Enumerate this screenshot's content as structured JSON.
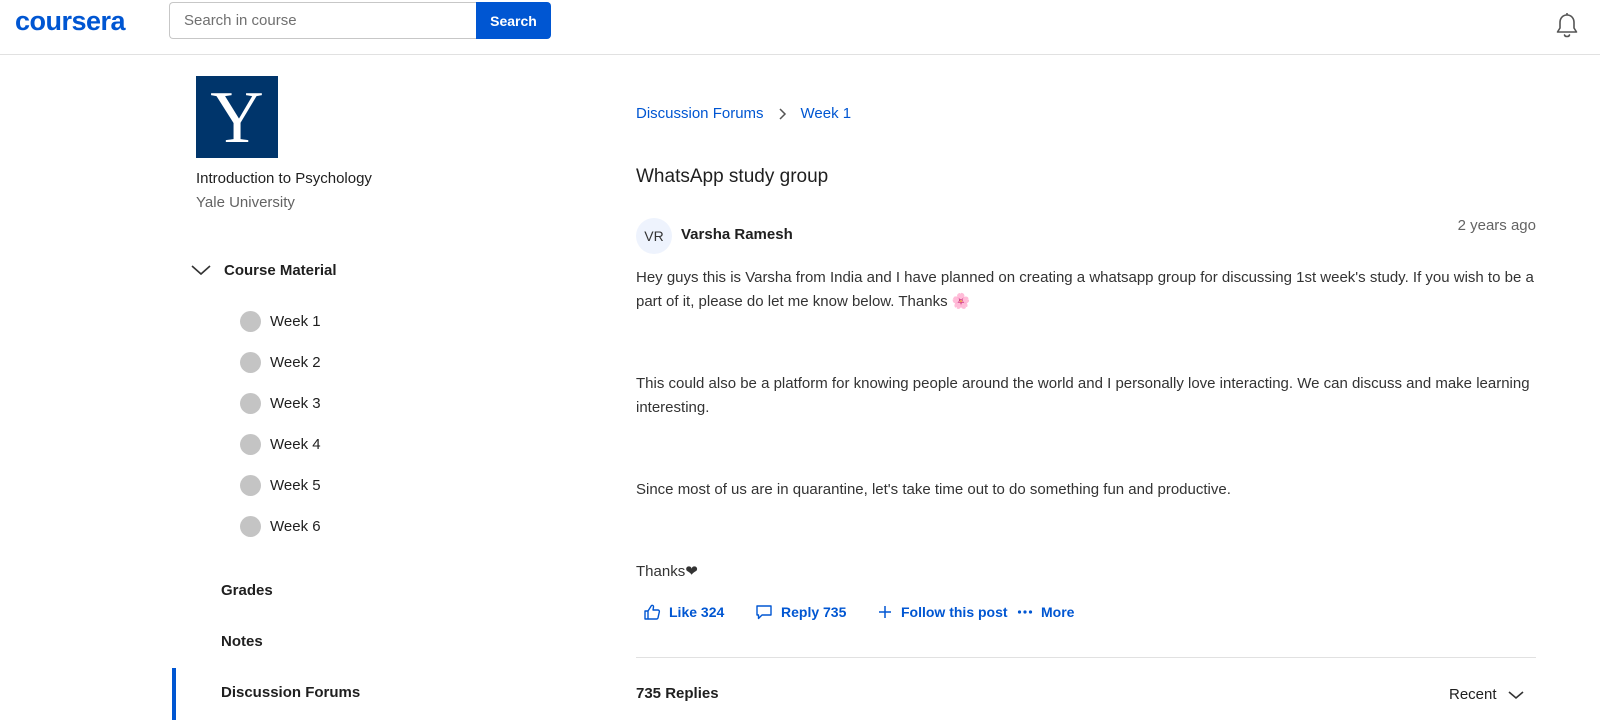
{
  "header": {
    "logo": "coursera",
    "search_placeholder": "Search in course",
    "search_button": "Search",
    "notification_icon": "bell-icon"
  },
  "sidebar": {
    "course_logo_letter": "Y",
    "course_title": "Introduction to Psychology",
    "university": "Yale University",
    "section_label": "Course Material",
    "weeks": [
      "Week 1",
      "Week 2",
      "Week 3",
      "Week 4",
      "Week 5",
      "Week 6"
    ],
    "nav": [
      "Grades",
      "Notes",
      "Discussion Forums"
    ],
    "active_nav": "Discussion Forums"
  },
  "breadcrumb": [
    "Discussion Forums",
    "Week 1"
  ],
  "post": {
    "title": "WhatsApp study group",
    "author_initials": "VR",
    "author": "Varsha Ramesh",
    "timestamp": "2 years ago",
    "paragraphs": [
      "Hey guys this is Varsha from India and I have planned on creating a whatsapp group for discussing 1st week's study. If you wish to be a part of it, please do let me know below. Thanks 🌸",
      "This could also be a platform for knowing people around the world and I personally love interacting. We can discuss and make learning interesting.",
      "Since most of us are in quarantine, let's take time out to do something fun and productive.",
      "Thanks❤"
    ]
  },
  "actions": {
    "like": "Like 324",
    "reply": "Reply 735",
    "follow": "Follow this post",
    "more": "More"
  },
  "replies": {
    "count_label": "735 Replies",
    "sort_label": "Recent"
  },
  "colors": {
    "brand": "#0056d2",
    "yale_blue": "#00356b"
  }
}
